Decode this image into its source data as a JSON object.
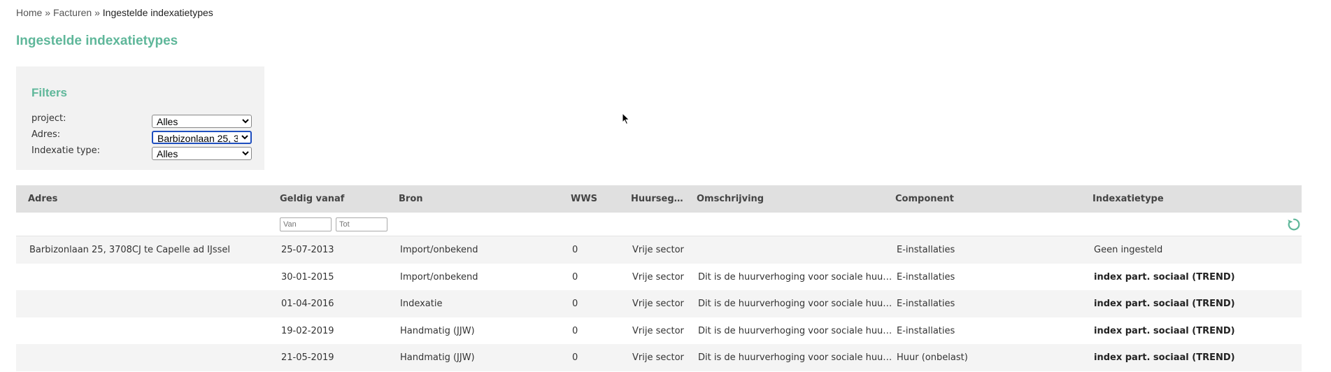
{
  "breadcrumb": {
    "home": "Home",
    "sep1": "»",
    "facturen": "Facturen",
    "sep2": "»",
    "current": "Ingestelde indexatietypes"
  },
  "page": {
    "title": "Ingestelde indexatietypes"
  },
  "filters": {
    "title": "Filters",
    "project": {
      "label": "project:",
      "value": "Alles"
    },
    "adres": {
      "label": "Adres:",
      "value": "Barbizonlaan 25, 3"
    },
    "indexatie_type": {
      "label": "Indexatie type:",
      "value": "Alles"
    }
  },
  "table": {
    "headers": {
      "adres": "Adres",
      "geldig_vanaf": "Geldig vanaf",
      "bron": "Bron",
      "wws": "WWS",
      "huursegment": "Huursegm...",
      "omschrijving": "Omschrijving",
      "component": "Component",
      "indexatietype": "Indexatietype"
    },
    "filter_inputs": {
      "van_placeholder": "Van",
      "tot_placeholder": "Tot"
    },
    "rows": [
      {
        "adres": "Barbizonlaan 25, 3708CJ te Capelle ad IJssel",
        "geldig_vanaf": "25-07-2013",
        "bron": "Import/onbekend",
        "wws": "0",
        "huursegment": "Vrije sector",
        "omschrijving": "",
        "component": "E-installaties",
        "indexatietype": "Geen ingesteld"
      },
      {
        "adres": "",
        "geldig_vanaf": "30-01-2015",
        "bron": "Import/onbekend",
        "wws": "0",
        "huursegment": "Vrije sector",
        "omschrijving": "Dit is de huurverhoging voor sociale huurw...",
        "component": "E-installaties",
        "indexatietype": "index part. sociaal (TREND)"
      },
      {
        "adres": "",
        "geldig_vanaf": "01-04-2016",
        "bron": "Indexatie",
        "wws": "0",
        "huursegment": "Vrije sector",
        "omschrijving": "Dit is de huurverhoging voor sociale huurw...",
        "component": "E-installaties",
        "indexatietype": "index part. sociaal (TREND)"
      },
      {
        "adres": "",
        "geldig_vanaf": "19-02-2019",
        "bron": "Handmatig (JJW)",
        "wws": "0",
        "huursegment": "Vrije sector",
        "omschrijving": "Dit is de huurverhoging voor sociale huurw...",
        "component": "E-installaties",
        "indexatietype": "index part. sociaal (TREND)"
      },
      {
        "adres": "",
        "geldig_vanaf": "21-05-2019",
        "bron": "Handmatig (JJW)",
        "wws": "0",
        "huursegment": "Vrije sector",
        "omschrijving": "Dit is de huurverhoging voor sociale huurw...",
        "component": "Huur (onbelast)",
        "indexatietype": "index part. sociaal (TREND)"
      }
    ]
  },
  "colors": {
    "accent": "#5fb79a",
    "header_bg": "#e0e0e0",
    "filter_bg": "#f2f2f2"
  },
  "icons": {
    "reset": "refresh-icon",
    "cursor": "mouse-cursor-icon"
  }
}
